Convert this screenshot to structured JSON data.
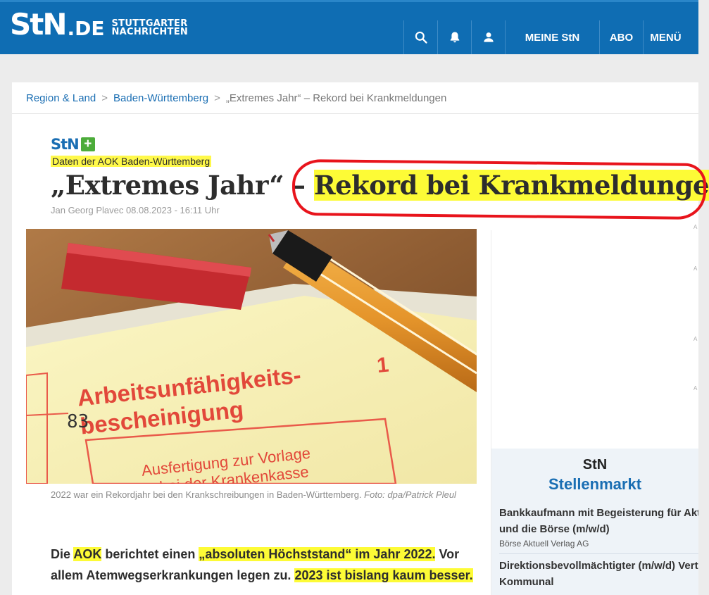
{
  "header": {
    "logo_main": "StN",
    "logo_domain": ".DE",
    "logo_city_line1": "STUTTGARTER",
    "logo_city_line2": "NACHRICHTEN",
    "search_icon": "search-icon",
    "bell_icon": "bell-icon",
    "user_icon": "user-icon",
    "meine_label": "MEINE StN",
    "abo_label": "ABO",
    "menu_label": "MENÜ",
    "brand_color": "#0f6db3"
  },
  "breadcrumb": {
    "items": [
      "Region & Land",
      "Baden-Württemberg",
      "„Extremes Jahr“ – Rekord bei Krankmeldungen"
    ],
    "separator": ">"
  },
  "article": {
    "plus_logo_text": "StN",
    "plus_logo_symbol": "+",
    "kicker": "Daten der AOK Baden-Württemberg",
    "headline_part1": "„Extremes Jahr“ – ",
    "headline_part2": "Rekord bei Krankmeldungen",
    "byline": "Jan Georg Plavec 08.08.2023 - 16:11 Uhr",
    "image": {
      "form_title_line1": "Arbeitsunfähigkeits-",
      "form_title_line2": "bescheinigung",
      "form_number": "1",
      "form_handwritten": "83",
      "form_box_line1": "Ausfertigung zur Vorlage",
      "form_box_line2": "bei der Krankenkasse"
    },
    "caption_text": "2022 war ein Rekordjahr bei den Krankschreibungen in Baden-Württemberg.",
    "caption_credit": "Foto: dpa/Patrick Pleul",
    "lead": {
      "p1": "Die ",
      "p2": "AOK",
      "p3": " berichtet einen ",
      "p4": "„absoluten Höchststand“ im Jahr 2022.",
      "p5": " Vor allem Atemwegserkrankungen legen zu. ",
      "p6": "2023 ist bislang kaum besser."
    },
    "highlight_color": "#fdfb36",
    "annotation_color": "#e8141c"
  },
  "sidebar": {
    "ad_marker": "A",
    "jobs_brand": "StN",
    "jobs_title": "Stellenmarkt",
    "jobs": [
      {
        "title_line1": "Bankkaufmann mit Begeisterung für Aktien",
        "title_line2": "und die Börse (m/w/d)",
        "company": "Börse Aktuell Verlag AG"
      },
      {
        "title_line1": "Direktionsbevollmächtigter (m/w/d) Vertrieb",
        "title_line2": "Kommunal",
        "company": ""
      }
    ]
  }
}
